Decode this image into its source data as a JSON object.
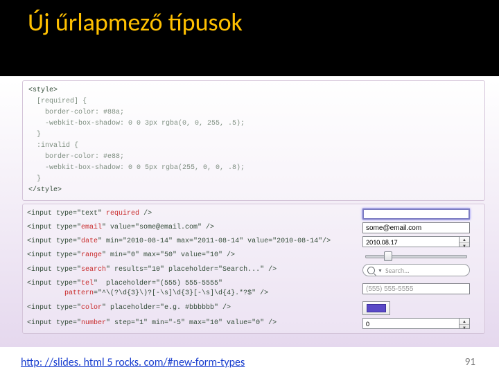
{
  "title": "Új űrlapmező típusok",
  "css_block": {
    "l1": "<style>",
    "l2": "  [required] {",
    "l3": "    border-color: #88a;",
    "l4": "    -webkit-box-shadow: 0 0 3px rgba(0, 0, 255, .5);",
    "l5": "  }",
    "l6": "  :invalid {",
    "l7": "    border-color: #e88;",
    "l8": "    -webkit-box-shadow: 0 0 5px rgba(255, 0, 0, .8);",
    "l9": "  }",
    "l10": "</style>"
  },
  "rows": {
    "text": {
      "code": "<input type=\"text\" required />"
    },
    "email": {
      "code": "<input type=\"email\" value=\"some@email.com\" />",
      "value": "some@email.com"
    },
    "date": {
      "code": "<input type=\"date\" min=\"2010-08-14\" max=\"2011-08-14\" value=\"2010-08-14\"/>",
      "value": "2010.08.17"
    },
    "range": {
      "code": "<input type=\"range\" min=\"0\" max=\"50\" value=\"10\" />",
      "thumb_pct": 20
    },
    "search": {
      "code": "<input type=\"search\" results=\"10\" placeholder=\"Search...\" />",
      "placeholder": "Search..."
    },
    "tel": {
      "code1": "<input type=\"tel\"  placeholder=\"(555) 555-5555\"",
      "code2": "         pattern=\"^\\(?\\d{3}\\)?[-\\s]\\d{3}[-\\s]\\d{4}.*?$\" />",
      "placeholder": "(555) 555-5555"
    },
    "color": {
      "code": "<input type=\"color\" placeholder=\"e.g. #bbbbbb\" />"
    },
    "number": {
      "code": "<input type=\"number\" step=\"1\" min=\"-5\" max=\"10\" value=\"0\" />",
      "value": "0"
    }
  },
  "footer": {
    "link": "http: //slides. html 5 rocks. com/#new-form-types",
    "page": "91"
  }
}
